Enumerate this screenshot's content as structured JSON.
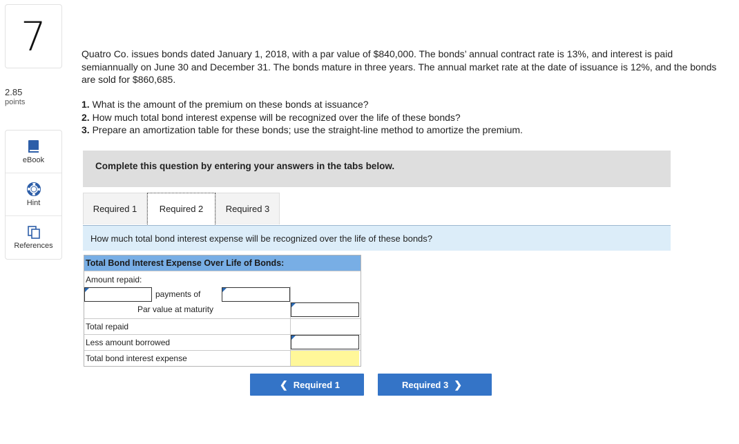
{
  "question": {
    "number": "7",
    "points_value": "2.85",
    "points_label": "points",
    "text": "Quatro Co. issues bonds dated January 1, 2018, with a par value of $840,000. The bonds’ annual contract rate is 13%, and interest is paid semiannually on June 30 and December 31. The bonds mature in three years. The annual market rate at the date of issuance is 12%, and the bonds are sold for $860,685.",
    "parts": [
      {
        "num": "1.",
        "text": "What is the amount of the premium on these bonds at issuance?"
      },
      {
        "num": "2.",
        "text": "How much total bond interest expense will be recognized over the life of these bonds?"
      },
      {
        "num": "3.",
        "text": "Prepare an amortization table for these bonds; use the straight-line method to amortize the premium."
      }
    ]
  },
  "tools": [
    {
      "label": "eBook",
      "icon": "book-icon"
    },
    {
      "label": "Hint",
      "icon": "lifebuoy-icon"
    },
    {
      "label": "References",
      "icon": "documents-icon"
    }
  ],
  "instructions": "Complete this question by entering your answers in the tabs below.",
  "tabs": [
    "Required 1",
    "Required 2",
    "Required 3"
  ],
  "active_tab": "Required 2",
  "sub_question": "How much total bond interest expense will be recognized over the life of these bonds?",
  "table": {
    "title": "Total Bond Interest Expense Over Life of Bonds:",
    "amount_repaid": "Amount repaid:",
    "payments_of": "payments of",
    "par_value": "Par value at maturity",
    "total_repaid": "Total repaid",
    "less_borrowed": "Less amount borrowed",
    "total_interest": "Total bond interest expense"
  },
  "nav": {
    "prev": "Required 1",
    "next": "Required 3"
  },
  "colors": {
    "accent": "#3474c7",
    "table_header": "#78aee5",
    "highlight": "#fff799",
    "subq_bg": "#dcedf9"
  }
}
